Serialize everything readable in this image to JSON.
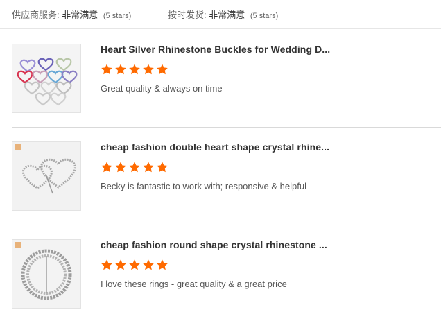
{
  "summary": {
    "supplier_service_label": "供应商服务:",
    "supplier_service_value": "非常满意",
    "supplier_service_stars": "(5 stars)",
    "shipping_label": "按时发货:",
    "shipping_value": "非常满意",
    "shipping_stars": "(5 stars)"
  },
  "reviews": [
    {
      "title": "Heart Silver Rhinestone Buckles for Wedding D...",
      "rating": 5,
      "comment": "Great quality & always on time",
      "image": "colored-heart-buckles-photo"
    },
    {
      "title": "cheap fashion double heart shape crystal rhine...",
      "rating": 5,
      "comment": "Becky is fantastic to work with; responsive & helpful",
      "image": "double-heart-buckle-photo"
    },
    {
      "title": "cheap fashion round shape crystal rhinestone ...",
      "rating": 5,
      "comment": "I love these rings - great quality & a great price",
      "image": "round-rhinestone-ring-photo"
    }
  ],
  "colors": {
    "star": "#ff6a00",
    "divider": "#d9d9d9",
    "title": "#333333",
    "comment": "#555555"
  }
}
